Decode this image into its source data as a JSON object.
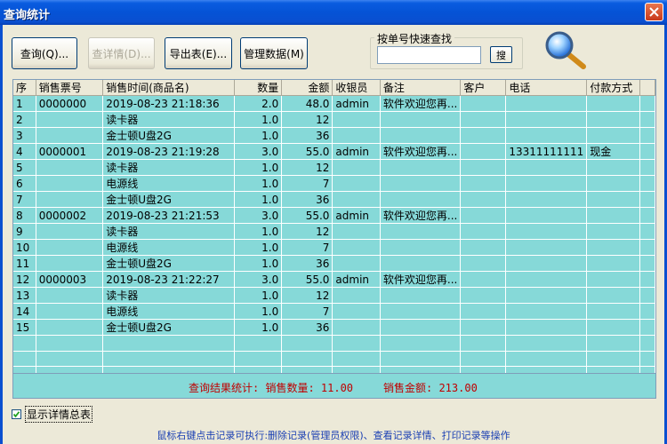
{
  "window": {
    "title": "查询统计"
  },
  "toolbar": {
    "query_label": "查询(Q)...",
    "detail_label": "查详情(D)...",
    "export_label": "导出表(E)...",
    "manage_label": "管理数据(M)"
  },
  "quick_search": {
    "group_label": "按单号快速查找",
    "input_value": "",
    "button_label": "搜"
  },
  "table": {
    "columns": [
      "序",
      "销售票号",
      "销售时间(商品名)",
      "数量",
      "金额",
      "收银员",
      "备注",
      "客户",
      "电话",
      "付款方式"
    ],
    "rows": [
      [
        "1",
        "0000000",
        "2019-08-23 21:18:36",
        "2.0",
        "48.0",
        "admin",
        "软件欢迎您再...",
        "",
        "",
        ""
      ],
      [
        "2",
        "",
        "读卡器",
        "1.0",
        "12",
        "",
        "",
        "",
        "",
        ""
      ],
      [
        "3",
        "",
        "金士顿U盘2G",
        "1.0",
        "36",
        "",
        "",
        "",
        "",
        ""
      ],
      [
        "4",
        "0000001",
        "2019-08-23 21:19:28",
        "3.0",
        "55.0",
        "admin",
        "软件欢迎您再...",
        "",
        "13311111111",
        "现金"
      ],
      [
        "5",
        "",
        "读卡器",
        "1.0",
        "12",
        "",
        "",
        "",
        "",
        ""
      ],
      [
        "6",
        "",
        "电源线",
        "1.0",
        "7",
        "",
        "",
        "",
        "",
        ""
      ],
      [
        "7",
        "",
        "金士顿U盘2G",
        "1.0",
        "36",
        "",
        "",
        "",
        "",
        ""
      ],
      [
        "8",
        "0000002",
        "2019-08-23 21:21:53",
        "3.0",
        "55.0",
        "admin",
        "软件欢迎您再...",
        "",
        "",
        ""
      ],
      [
        "9",
        "",
        "读卡器",
        "1.0",
        "12",
        "",
        "",
        "",
        "",
        ""
      ],
      [
        "10",
        "",
        "电源线",
        "1.0",
        "7",
        "",
        "",
        "",
        "",
        ""
      ],
      [
        "11",
        "",
        "金士顿U盘2G",
        "1.0",
        "36",
        "",
        "",
        "",
        "",
        ""
      ],
      [
        "12",
        "0000003",
        "2019-08-23 21:22:27",
        "3.0",
        "55.0",
        "admin",
        "软件欢迎您再...",
        "",
        "",
        ""
      ],
      [
        "13",
        "",
        "读卡器",
        "1.0",
        "12",
        "",
        "",
        "",
        "",
        ""
      ],
      [
        "14",
        "",
        "电源线",
        "1.0",
        "7",
        "",
        "",
        "",
        "",
        ""
      ],
      [
        "15",
        "",
        "金士顿U盘2G",
        "1.0",
        "36",
        "",
        "",
        "",
        "",
        ""
      ]
    ]
  },
  "summary": {
    "quantity_text": "查询结果统计: 销售数量: 11.00",
    "amount_text": "销售金额: 213.00"
  },
  "show_detail": {
    "label": "显示详情总表",
    "checked": true
  },
  "footer": {
    "hint": "鼠标右键点击记录可执行:删除记录(管理员权限)、查看记录详情、打印记录等操作"
  },
  "colors": {
    "grid_row": "#86d9d8",
    "summary_text": "#c00000",
    "titlebar": "#0553d6",
    "footer_text": "#1a3fb3"
  },
  "icons": {
    "magnifier": "magnifier-icon",
    "close": "close-icon",
    "checkbox": "check-icon"
  }
}
